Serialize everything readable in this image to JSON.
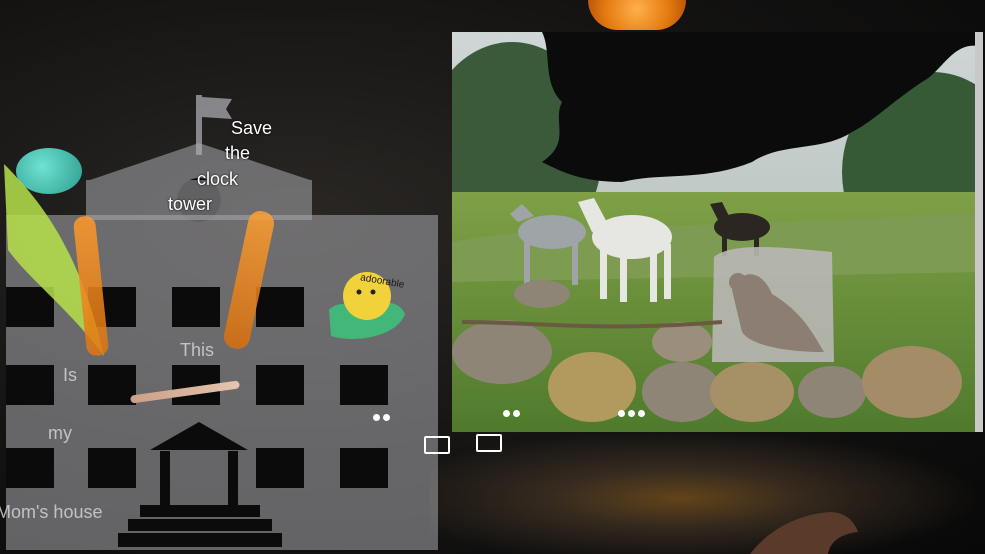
{
  "collage": {
    "heading": [
      "Save",
      "the",
      "clock",
      "tower"
    ],
    "story": [
      "This",
      "Is",
      "my",
      "Mom's house"
    ],
    "toy_label": "adoorable"
  },
  "icons": {
    "photo_icon": "image-icon",
    "frame_icon": "frame-icon"
  },
  "colors": {
    "background": "#0b0b0b",
    "house_overlay": "#a9a9af",
    "accent_orange": "#e07510",
    "accent_lime": "#b6e04a",
    "grass": "#5f8f35"
  }
}
